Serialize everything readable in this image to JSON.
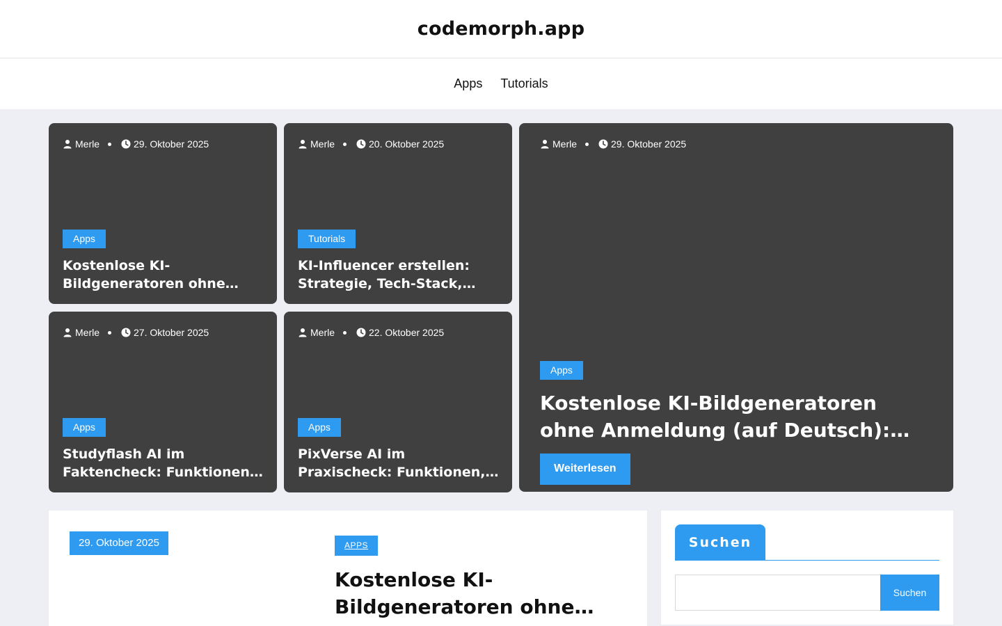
{
  "site": {
    "title": "codemorph.app"
  },
  "nav": {
    "items": [
      {
        "label": "Apps"
      },
      {
        "label": "Tutorials"
      }
    ]
  },
  "featured": [
    {
      "author": "Merle",
      "date": "29. Oktober 2025",
      "category": "Apps",
      "title": "Kostenlose KI-Bildgeneratoren ohne Anmeldung (auf Deutsch): Der große Vergleich"
    },
    {
      "author": "Merle",
      "date": "20. Oktober 2025",
      "category": "Tutorials",
      "title": "KI-Influencer erstellen: Strategie, Tech-Stack, Monetarisierung"
    },
    {
      "author": "Merle",
      "date": "27. Oktober 2025",
      "category": "Apps",
      "title": "Studyflash AI im Faktencheck: Funktionen, Technik, Preise, Alternativen"
    },
    {
      "author": "Merle",
      "date": "22. Oktober 2025",
      "category": "Apps",
      "title": "PixVerse AI im Praxischeck: Funktionen, Qualität, Preise, Alternativen"
    },
    {
      "author": "Merle",
      "date": "29. Oktober 2025",
      "category": "Apps",
      "title": "Kostenlose KI-Bildgeneratoren ohne Anmeldung (auf Deutsch): Der große Vergleich",
      "read_more": "Weiterlesen"
    }
  ],
  "article": {
    "date": "29. Oktober 2025",
    "category": "APPS",
    "title": "Kostenlose KI-Bildgeneratoren ohne Anmeldung (auf Deutsch): Der große Vergleich"
  },
  "sidebar": {
    "widget_title": "Suchen",
    "search_value": "",
    "search_button": "Suchen"
  },
  "colors": {
    "accent": "#2f9bf0",
    "card_bg": "#404041",
    "page_bg": "#eeeef5"
  },
  "icons": {
    "author": "user-icon",
    "date": "clock-icon"
  }
}
